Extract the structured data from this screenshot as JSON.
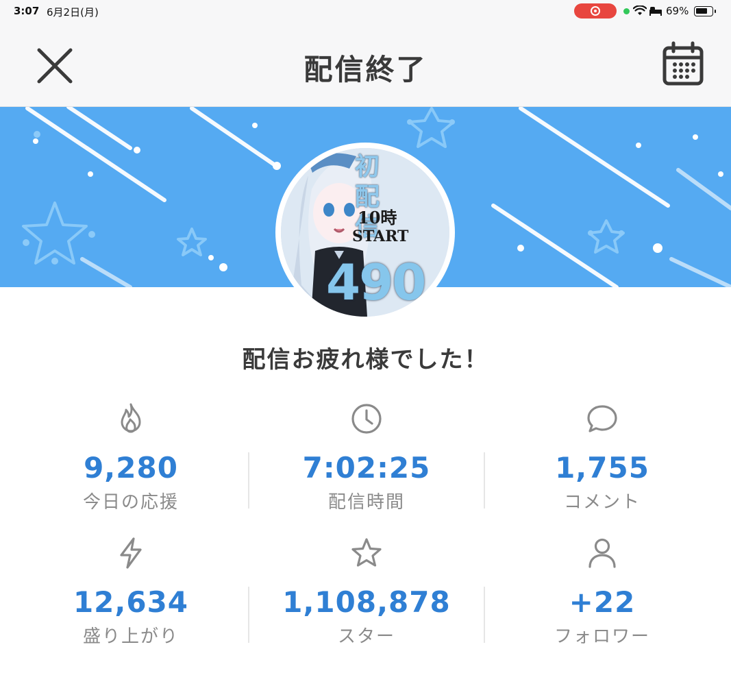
{
  "status_bar": {
    "time": "3:07",
    "date": "6月2日(月)",
    "battery": "69%",
    "battery_level": 0.69
  },
  "header": {
    "title": "配信終了",
    "close_icon": "close-icon",
    "calendar_icon": "calendar-icon"
  },
  "banner": {
    "avatar_text": {
      "line1": "初配信",
      "time": "10時",
      "start": "START",
      "number": "490"
    }
  },
  "message": "配信お疲れ様でした！",
  "stats": [
    {
      "icon": "fire-icon",
      "value": "9,280",
      "label": "今日の応援"
    },
    {
      "icon": "clock-icon",
      "value": "7:02:25",
      "label": "配信時間"
    },
    {
      "icon": "comment-icon",
      "value": "1,755",
      "label": "コメント"
    },
    {
      "icon": "lightning-icon",
      "value": "12,634",
      "label": "盛り上がり"
    },
    {
      "icon": "star-icon",
      "value": "1,108,878",
      "label": "スター"
    },
    {
      "icon": "user-icon",
      "value": "+22",
      "label": "フォロワー"
    }
  ],
  "colors": {
    "accent": "#2f7fd4",
    "banner": "#55aaf2",
    "label": "#8a8a8a",
    "title": "#3a3a3a"
  }
}
